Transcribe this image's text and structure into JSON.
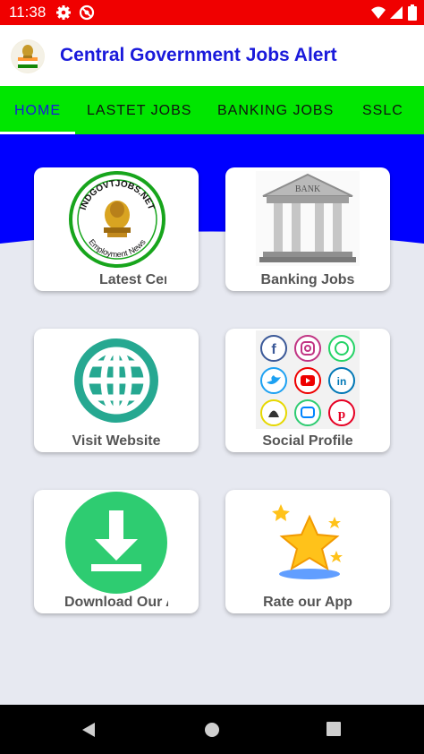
{
  "status_bar": {
    "time": "11:38",
    "icons": [
      "gear-icon",
      "no-disturb-icon",
      "wifi-icon",
      "signal-icon",
      "battery-icon"
    ]
  },
  "app_bar": {
    "title": "Central Government Jobs Alert",
    "logo": "emblem-logo-icon"
  },
  "tabs": [
    {
      "label": "HOME",
      "active": true
    },
    {
      "label": "LASTET JOBS"
    },
    {
      "label": "BANKING JOBS"
    },
    {
      "label": "SSLC"
    }
  ],
  "cards": [
    {
      "label": "Latest Cer",
      "art": "indgovtjobs-logo",
      "logo_top": "INDGOVTJOBS.NET",
      "logo_bottom": "Employment News"
    },
    {
      "label": "Banking Jobs",
      "art": "bank-building-icon",
      "bank_sign": "BANK"
    },
    {
      "label": "Visit Website",
      "art": "globe-icon"
    },
    {
      "label": "Social Profile",
      "art": "social-icons-grid",
      "social_icons": [
        "facebook-icon",
        "instagram-icon",
        "whatsapp-icon",
        "twitter-icon",
        "youtube-icon",
        "linkedin-icon",
        "snapchat-icon",
        "messenger-icon",
        "pinterest-icon"
      ]
    },
    {
      "label": "Download Our A",
      "art": "download-icon"
    },
    {
      "label": "Rate our App",
      "art": "star-icon"
    }
  ],
  "colors": {
    "status": "#f00000",
    "title": "#1a1adb",
    "tabs_bg": "#00e600",
    "hero": "#0000ff",
    "globe": "#26a891",
    "download": "#2ecc71"
  },
  "nav_bar": [
    "back-icon",
    "home-icon",
    "recents-icon"
  ]
}
